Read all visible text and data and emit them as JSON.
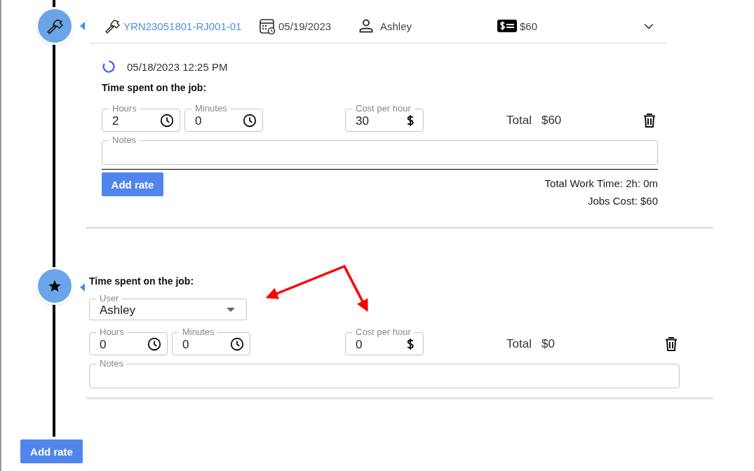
{
  "entries": [
    {
      "kind": "job",
      "header": {
        "job_number": "YRN23051801-RJ001-01",
        "date": "05/19/2023",
        "user": "Ashley",
        "amount": "$60",
        "expanded": true
      },
      "timestamp": "05/18/2023 12:25 PM",
      "section_title": "Time spent on the job:",
      "rates": [
        {
          "hours": {
            "label": "Hours",
            "value": "2"
          },
          "minutes": {
            "label": "Minutes",
            "value": "0"
          },
          "cost": {
            "label": "Cost per hour",
            "value": "30"
          },
          "total_label": "Total",
          "total": "$60",
          "notes": {
            "label": "Notes"
          }
        }
      ],
      "add_button": "Add rate",
      "summary": [
        "Total Work Time: 2h: 0m",
        "Jobs Cost: $60"
      ]
    },
    {
      "kind": "new_rate",
      "section_title": "Time spent on the job:",
      "user_field": {
        "label": "User",
        "value": "Ashley"
      },
      "rates": [
        {
          "hours": {
            "label": "Hours",
            "value": "0"
          },
          "minutes": {
            "label": "Minutes",
            "value": "0"
          },
          "cost": {
            "label": "Cost per hour",
            "value": "0"
          },
          "total_label": "Total",
          "total": "$0",
          "notes": {
            "label": "Notes"
          }
        }
      ]
    }
  ],
  "add_button": "Add rate"
}
